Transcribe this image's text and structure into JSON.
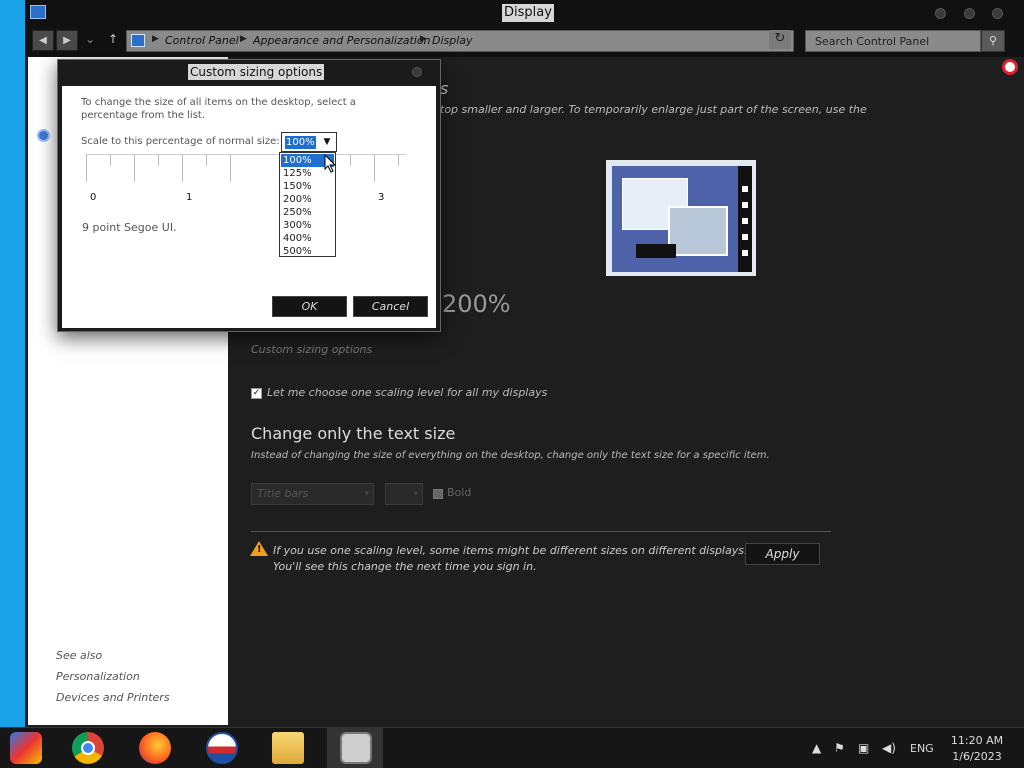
{
  "window": {
    "title": "Display",
    "breadcrumbs": [
      "Control Panel",
      "Appearance and Personalization",
      "Display"
    ],
    "search_placeholder": "Search Control Panel"
  },
  "left_pane": {
    "see_also_heading": "See also",
    "links": [
      "Personalization",
      "Devices and Printers"
    ]
  },
  "content": {
    "heading_fragment": "s",
    "intro": "top smaller and larger. To temporarily enlarge just part of the screen, use the",
    "scale_value_visible": "200%",
    "custom_sizing_link": "Custom sizing options",
    "checkbox_label": "Let me choose one scaling level for all my displays",
    "checkbox_checked": true,
    "text_size_heading": "Change only the text size",
    "text_size_desc": "Instead of changing the size of everything on the desktop, change only the text size for a specific item.",
    "item_dropdown": "Title bars",
    "size_dropdown": "",
    "bold_label": "Bold",
    "warning_line1": "If you use one scaling level, some items might be different sizes on different displays.",
    "warning_line2": "You'll see this change the next time you sign in.",
    "apply_label": "Apply"
  },
  "dialog": {
    "title": "Custom sizing options",
    "description": "To change the size of all items on the desktop, select a percentage from the list.",
    "scale_label": "Scale to this percentage of normal size:",
    "selected": "100%",
    "options": [
      "100%",
      "125%",
      "150%",
      "200%",
      "250%",
      "300%",
      "400%",
      "500%"
    ],
    "ruler_numbers": [
      "0",
      "1",
      "3"
    ],
    "font_note": "9 point Segoe UI.",
    "ok_label": "OK",
    "cancel_label": "Cancel"
  },
  "taskbar": {
    "apps": [
      "chrome-icon",
      "firefox-icon",
      "obama-logo-icon",
      "file-explorer-icon",
      "control-panel-icon"
    ],
    "language": "ENG",
    "time": "11:20 AM",
    "date": "1/6/2023"
  },
  "colors": {
    "accent": "#1e6fd0",
    "window_bg": "#1e1e1e",
    "desktop": "#1aa3e8",
    "warning": "#f0a020"
  }
}
